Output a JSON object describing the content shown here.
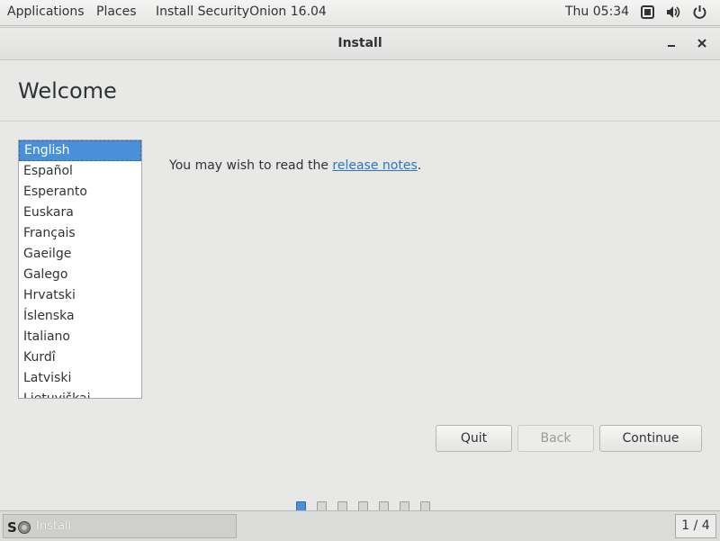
{
  "topbar": {
    "applications": "Applications",
    "places": "Places",
    "app_name": "Install SecurityOnion 16.04",
    "clock": "Thu 05:34",
    "icons": [
      "screen-icon",
      "volume-icon",
      "power-icon"
    ]
  },
  "window": {
    "title": "Install",
    "welcome": "Welcome"
  },
  "languages": {
    "selected": "English",
    "items": [
      "English",
      "Español",
      "Esperanto",
      "Euskara",
      "Français",
      "Gaeilge",
      "Galego",
      "Hrvatski",
      "Íslenska",
      "Italiano",
      "Kurdî",
      "Latviski",
      "Lietuviškai"
    ]
  },
  "release": {
    "prefix": "You may wish to read the ",
    "link": "release notes",
    "suffix": "."
  },
  "buttons": {
    "quit": "Quit",
    "back": "Back",
    "continue": "Continue"
  },
  "progress": {
    "total_steps": 7,
    "current_step": 1
  },
  "taskbar": {
    "task_label": "Install",
    "workspace": "1 / 4"
  },
  "colors": {
    "accent": "#4a90d9",
    "link": "#2a76c6"
  }
}
